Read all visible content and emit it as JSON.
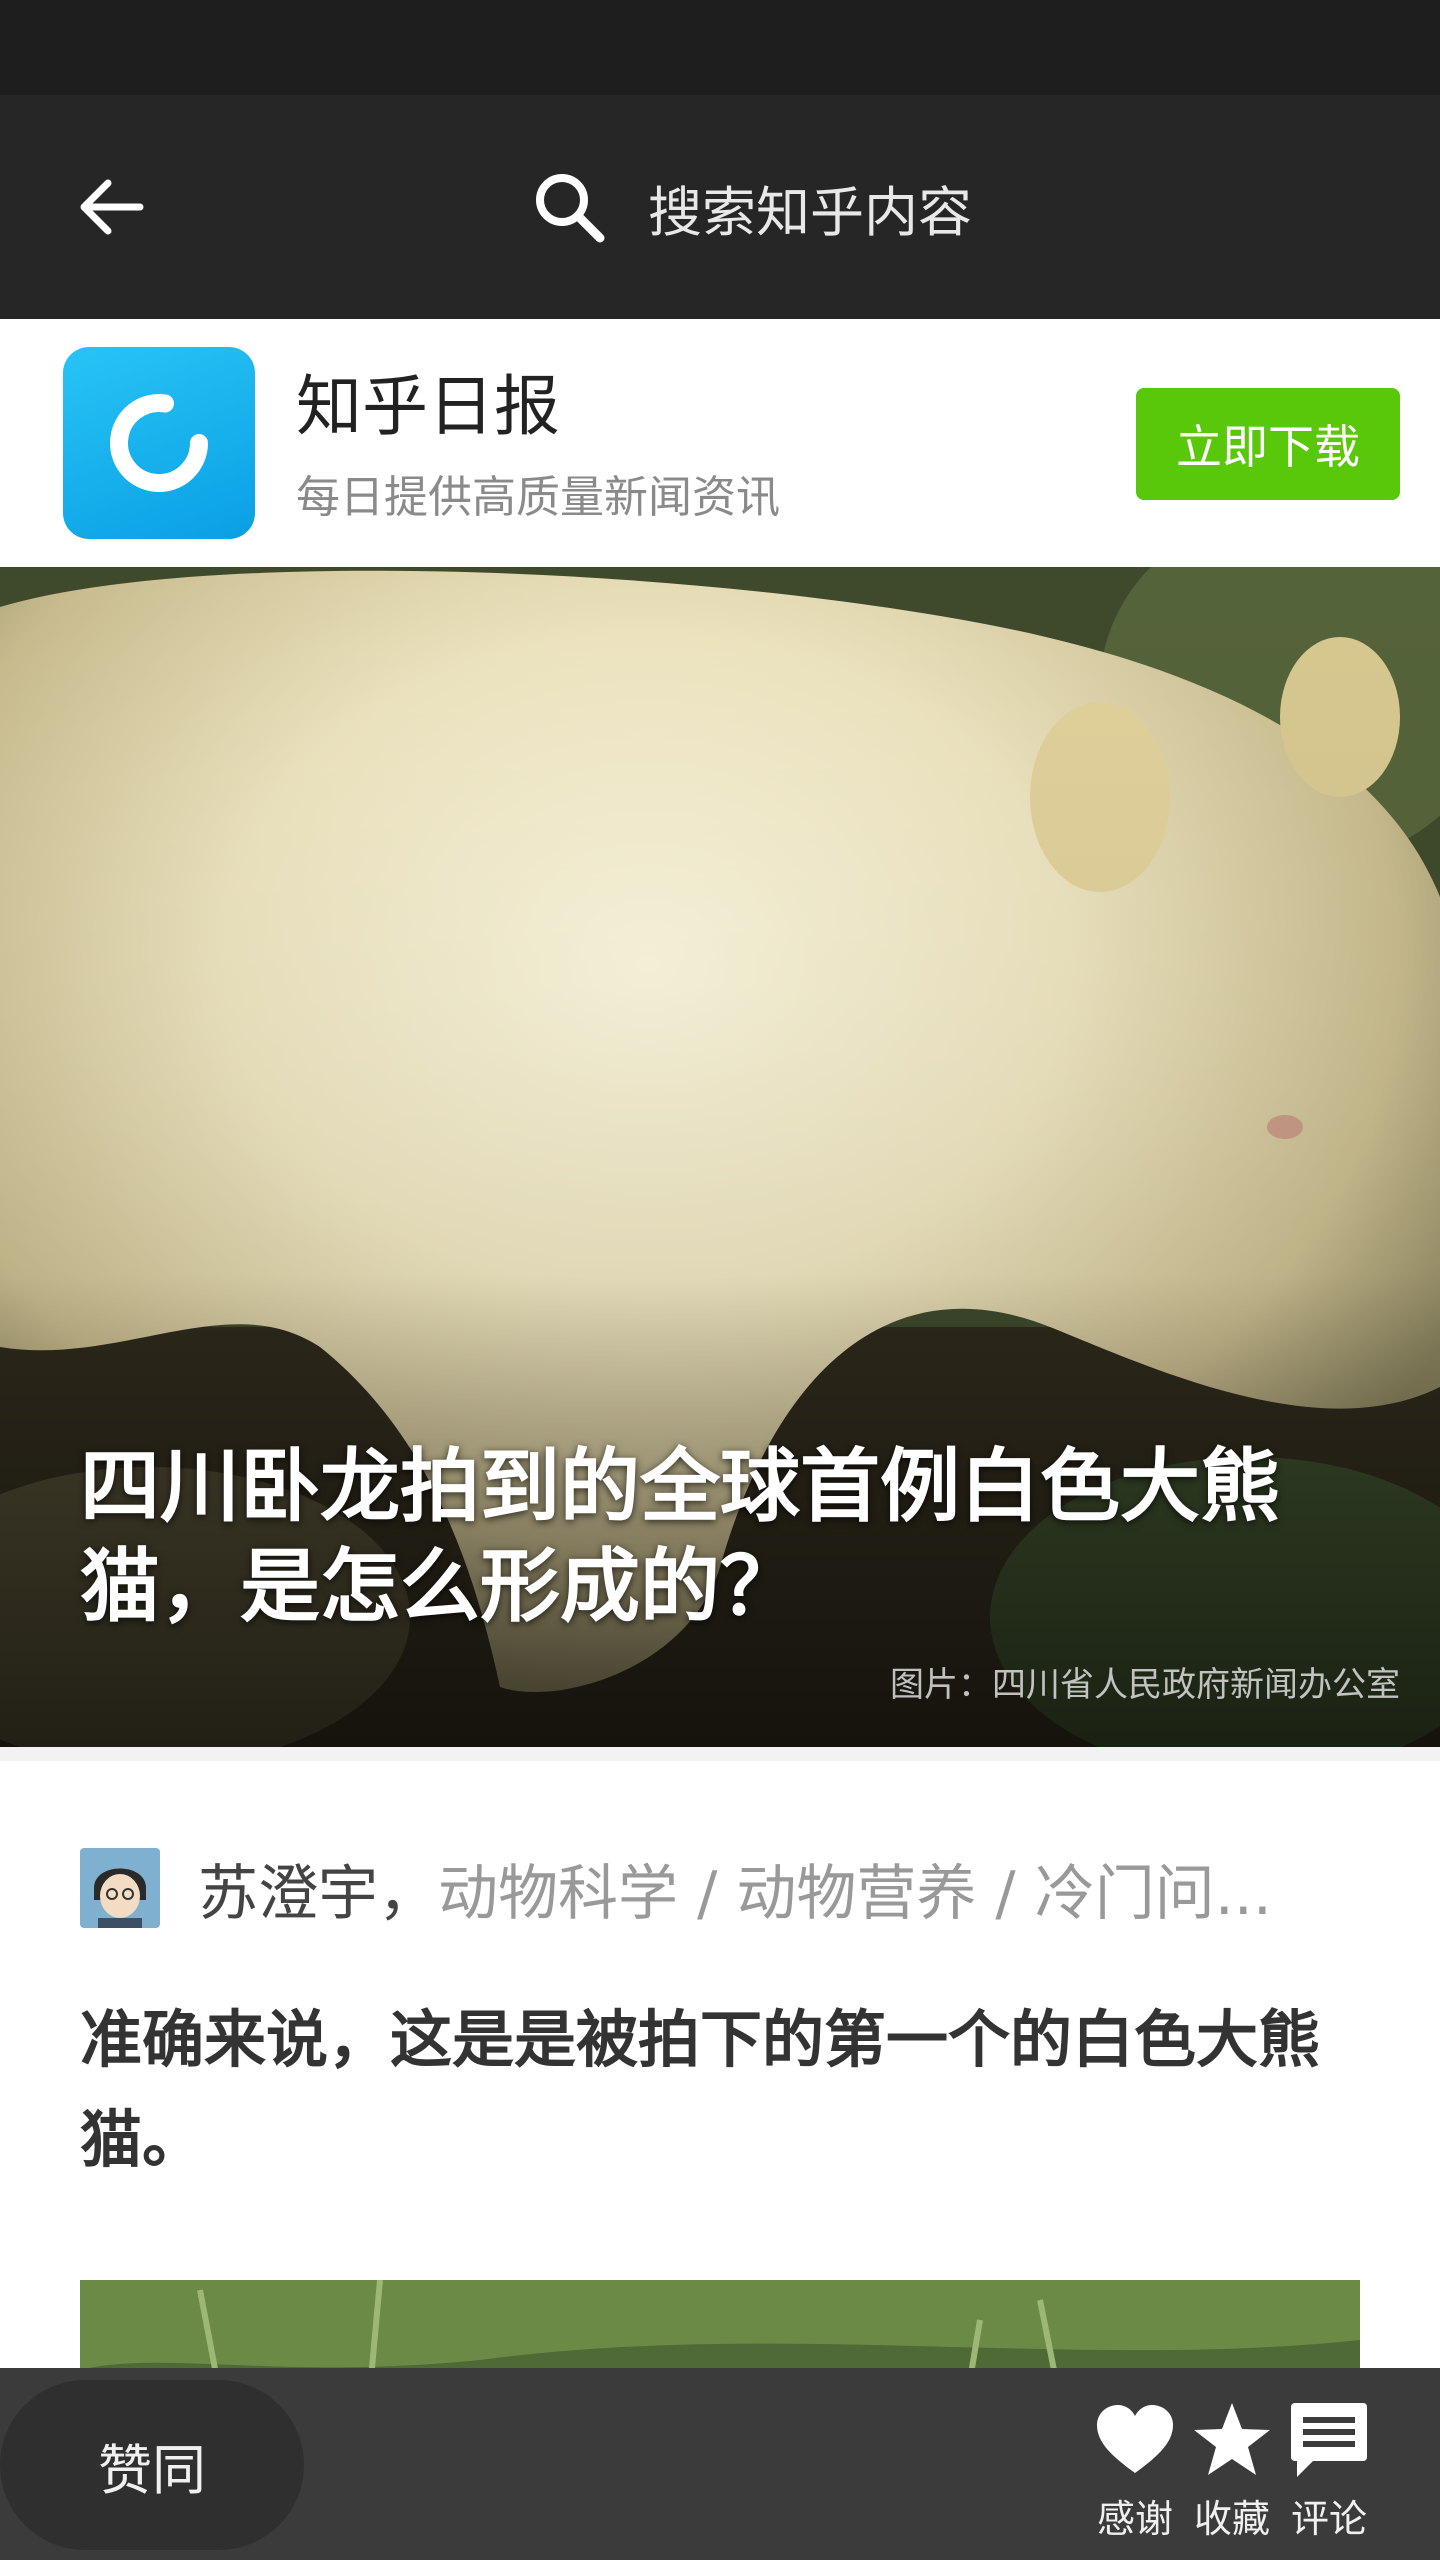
{
  "toolbar": {
    "back_icon": "arrow-left-icon",
    "search_icon": "search-icon",
    "search_placeholder": "搜索知乎内容"
  },
  "promo": {
    "app_name": "知乎日报",
    "app_desc": "每日提供高质量新闻资讯",
    "download_label": "立即下载",
    "download_color": "#5ac80a"
  },
  "hero": {
    "title": "四川卧龙拍到的全球首例白色大熊猫，是怎么形成的？",
    "credit": "图片：四川省人民政府新闻办公室"
  },
  "answer": {
    "author_name": "苏澄宇，",
    "author_bio": "动物科学 / 动物营养 / 冷门问...",
    "lead": "准确来说，这是是被拍下的第一个的白色大熊猫。"
  },
  "bottom_bar": {
    "vote_label": "赞同",
    "actions": [
      {
        "icon": "heart-icon",
        "label": "感谢"
      },
      {
        "icon": "star-icon",
        "label": "收藏"
      },
      {
        "icon": "comment-icon",
        "label": "评论"
      }
    ]
  }
}
